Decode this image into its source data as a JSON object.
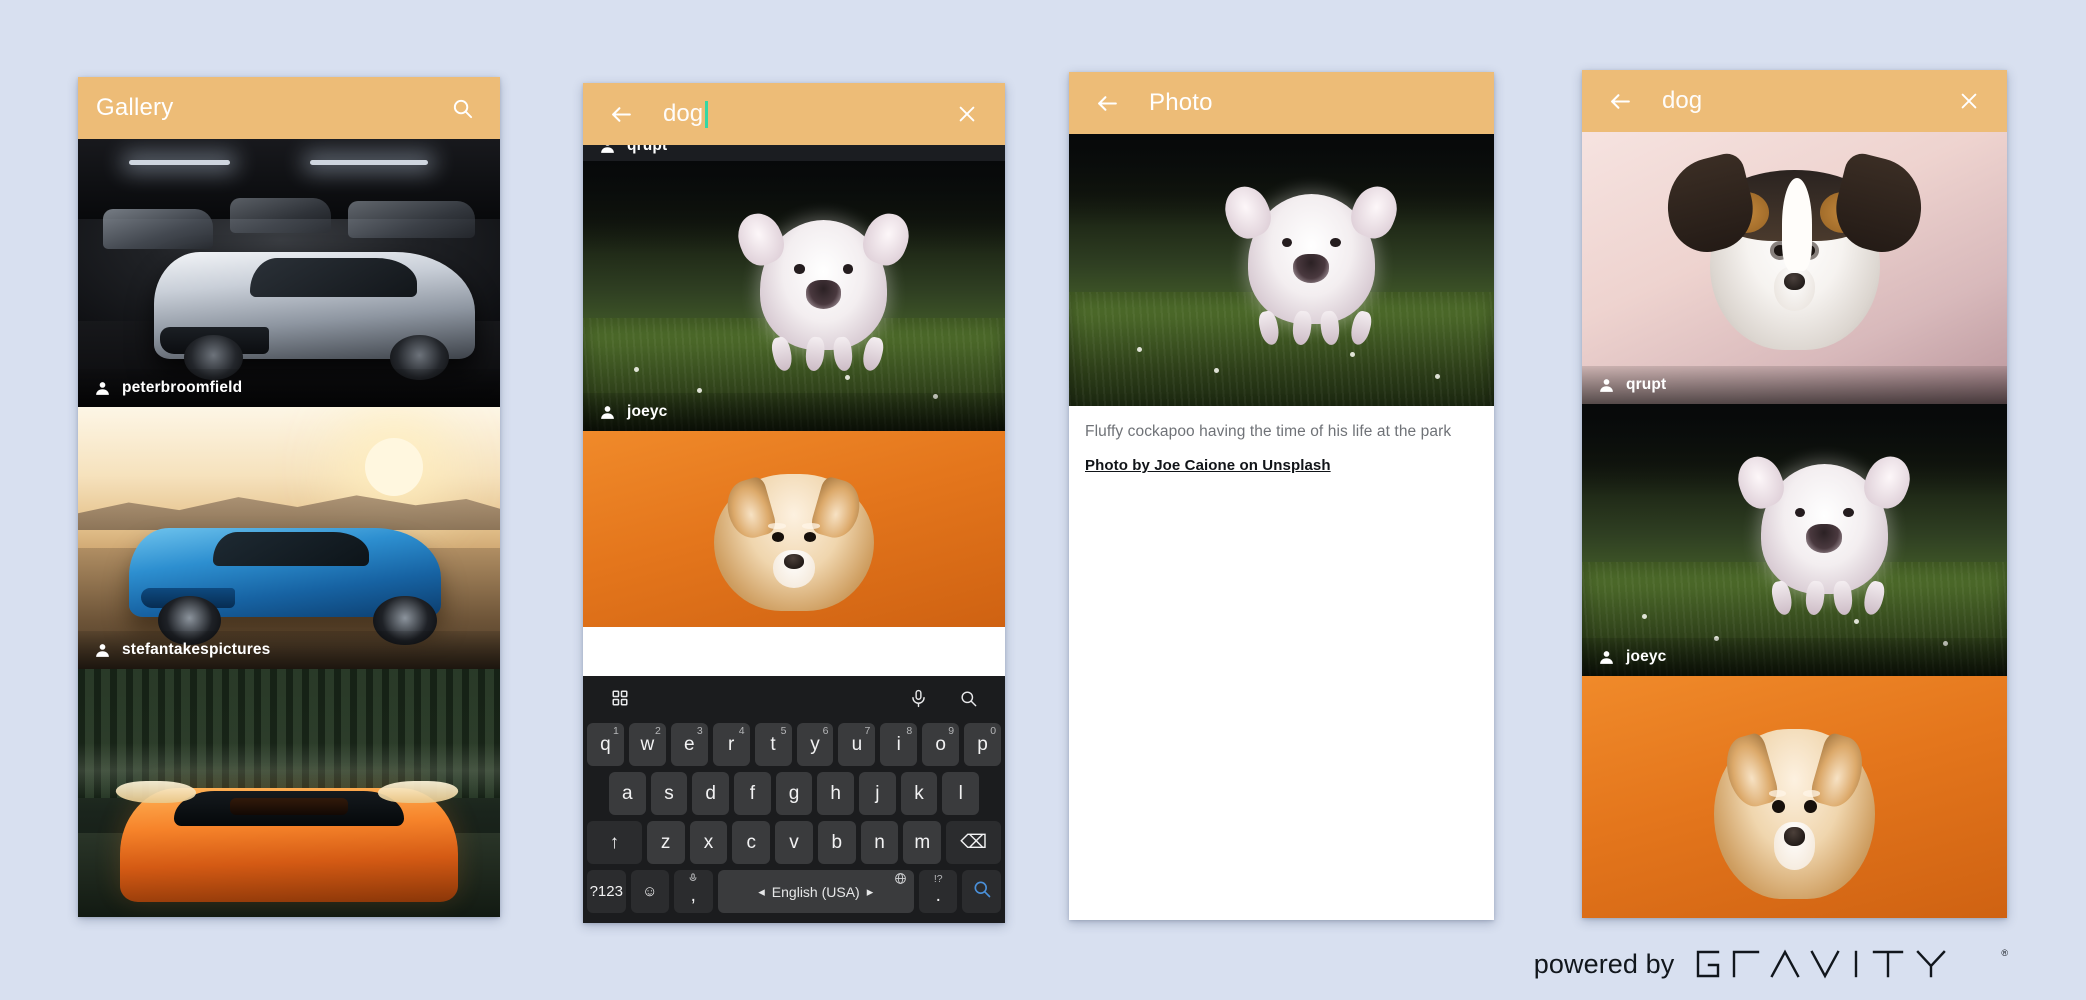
{
  "meta": {
    "background_color": "#d8e0f0",
    "accent_color": "#edbc77",
    "cursor_color": "#35d6a4"
  },
  "panels": {
    "gallery": {
      "appbar": {
        "title": "Gallery",
        "search_icon": "search-icon"
      },
      "items": [
        {
          "credit": "peterbroomfield",
          "scene": "dark-garage-white-muscle-car"
        },
        {
          "credit": "stefantakespictures",
          "scene": "blue-sports-car-desert-sunset"
        },
        {
          "credit": "",
          "scene": "orange-supercar-dark-lake"
        }
      ]
    },
    "search": {
      "appbar": {
        "back_icon": "arrow-left-icon",
        "query": "dog",
        "close_icon": "close-icon",
        "has_caret": true
      },
      "partial_top_credit": "qrupt",
      "items": [
        {
          "credit": "joeyc",
          "scene": "white-cockapoo-running-grass"
        },
        {
          "credit": "",
          "scene": "corgi-puppy-orange-background"
        }
      ],
      "keyboard": {
        "toolbar": {
          "grid_icon": "keyboard-grid-icon",
          "mic_icon": "microphone-icon",
          "search_icon": "search-icon"
        },
        "row1": [
          {
            "key": "q",
            "sup": "1"
          },
          {
            "key": "w",
            "sup": "2"
          },
          {
            "key": "e",
            "sup": "3"
          },
          {
            "key": "r",
            "sup": "4"
          },
          {
            "key": "t",
            "sup": "5"
          },
          {
            "key": "y",
            "sup": "6"
          },
          {
            "key": "u",
            "sup": "7"
          },
          {
            "key": "i",
            "sup": "8"
          },
          {
            "key": "o",
            "sup": "9"
          },
          {
            "key": "p",
            "sup": "0"
          }
        ],
        "row2": [
          "a",
          "s",
          "d",
          "f",
          "g",
          "h",
          "j",
          "k",
          "l"
        ],
        "row3": [
          {
            "key": "↑",
            "type": "shift"
          },
          {
            "key": "z"
          },
          {
            "key": "x"
          },
          {
            "key": "c"
          },
          {
            "key": "v"
          },
          {
            "key": "b"
          },
          {
            "key": "n"
          },
          {
            "key": "m"
          },
          {
            "key": "⌫",
            "type": "backspace"
          }
        ],
        "row4": {
          "numeric": "?123",
          "emoji": "☺",
          "comma": ",",
          "comma_sup": "mic-icon",
          "space_label": "English (USA)",
          "space_left_arrow": "◂",
          "space_right_arrow": "▸",
          "globe": "globe-icon",
          "period": ".",
          "period_sup": "!?",
          "action": "search-icon"
        }
      }
    },
    "photo": {
      "appbar": {
        "back_icon": "arrow-left-icon",
        "title": "Photo"
      },
      "scene": "white-cockapoo-running-grass",
      "caption": "Fluffy cockapoo having the time of his life at the park",
      "link": "Photo by Joe Caione on Unsplash"
    },
    "results": {
      "appbar": {
        "back_icon": "arrow-left-icon",
        "query": "dog",
        "close_icon": "close-icon",
        "has_caret": false
      },
      "items": [
        {
          "credit": "qrupt",
          "scene": "jack-russell-head-pink-background"
        },
        {
          "credit": "joeyc",
          "scene": "white-cockapoo-running-grass"
        },
        {
          "credit": "",
          "scene": "corgi-puppy-orange-background"
        }
      ]
    }
  },
  "branding": {
    "prefix": "powered by",
    "name": "GRAVITY",
    "registered": "®"
  }
}
